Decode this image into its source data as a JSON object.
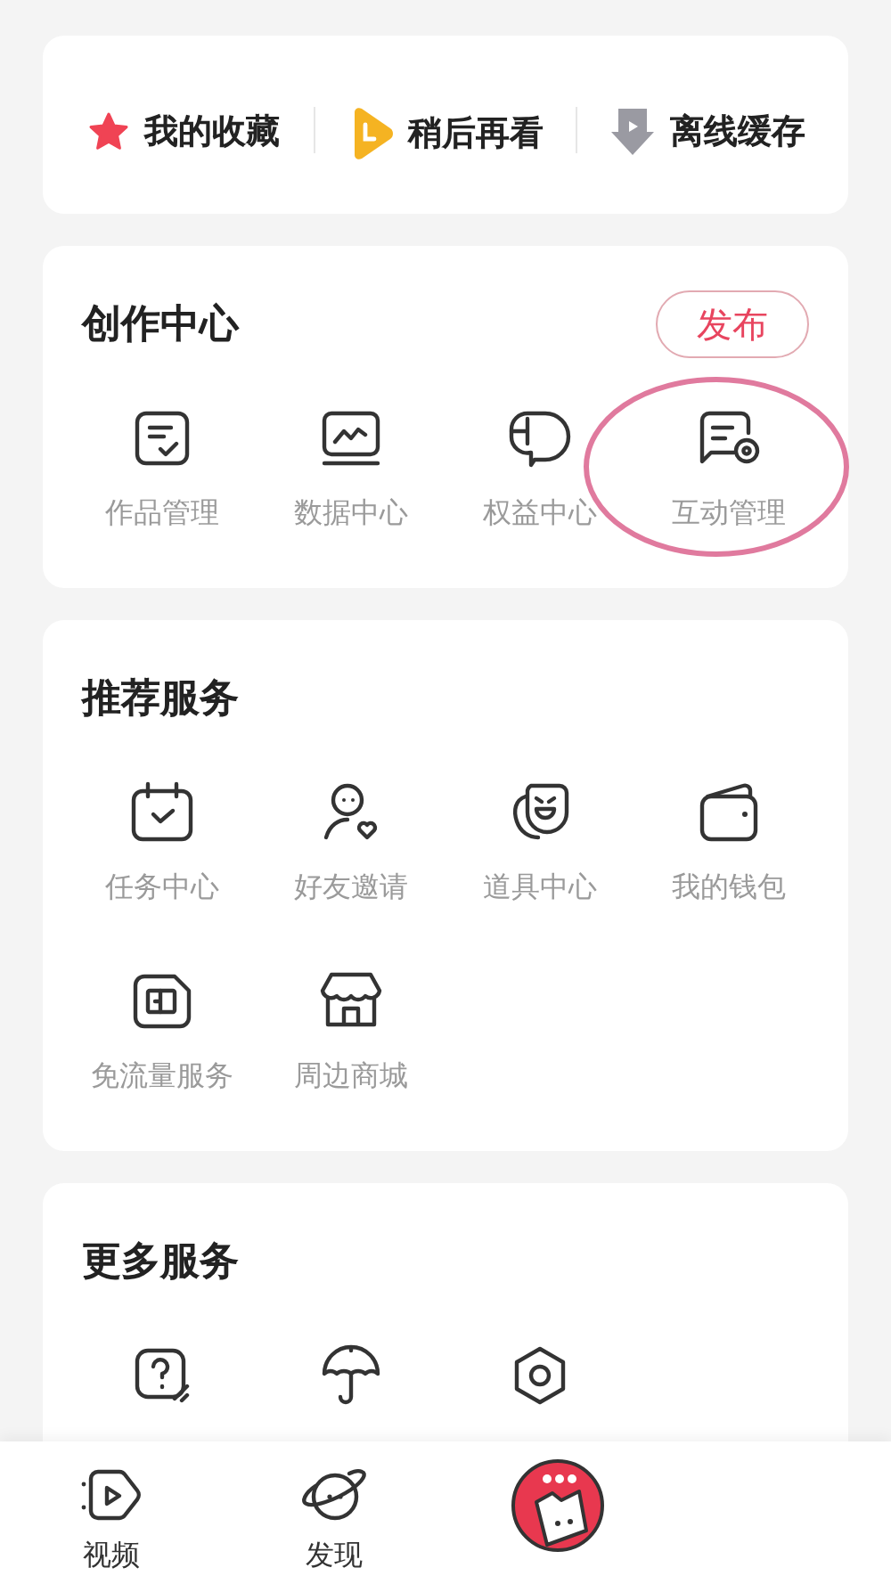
{
  "shortcuts": [
    {
      "label": "我的收藏"
    },
    {
      "label": "稍后再看"
    },
    {
      "label": "离线缓存"
    }
  ],
  "sections": [
    {
      "title": "创作中心",
      "action": "发布",
      "items": [
        {
          "label": "作品管理",
          "highlighted": false
        },
        {
          "label": "数据中心",
          "highlighted": false
        },
        {
          "label": "权益中心",
          "highlighted": false
        },
        {
          "label": "互动管理",
          "highlighted": true
        }
      ]
    },
    {
      "title": "推荐服务",
      "items": [
        {
          "label": "任务中心",
          "highlighted": false
        },
        {
          "label": "好友邀请",
          "highlighted": false
        },
        {
          "label": "道具中心",
          "highlighted": false
        },
        {
          "label": "我的钱包",
          "highlighted": false
        },
        {
          "label": "免流量服务",
          "highlighted": false
        },
        {
          "label": "周边商城",
          "highlighted": false
        }
      ]
    },
    {
      "title": "更多服务",
      "items": [
        {
          "highlighted": false
        },
        {
          "highlighted": false
        },
        {
          "highlighted": false
        }
      ]
    }
  ],
  "tab_bar": [
    {
      "label": "视频",
      "kind": "tab"
    },
    {
      "label": "发现",
      "kind": "tab"
    },
    {
      "kind": "avatar"
    }
  ]
}
